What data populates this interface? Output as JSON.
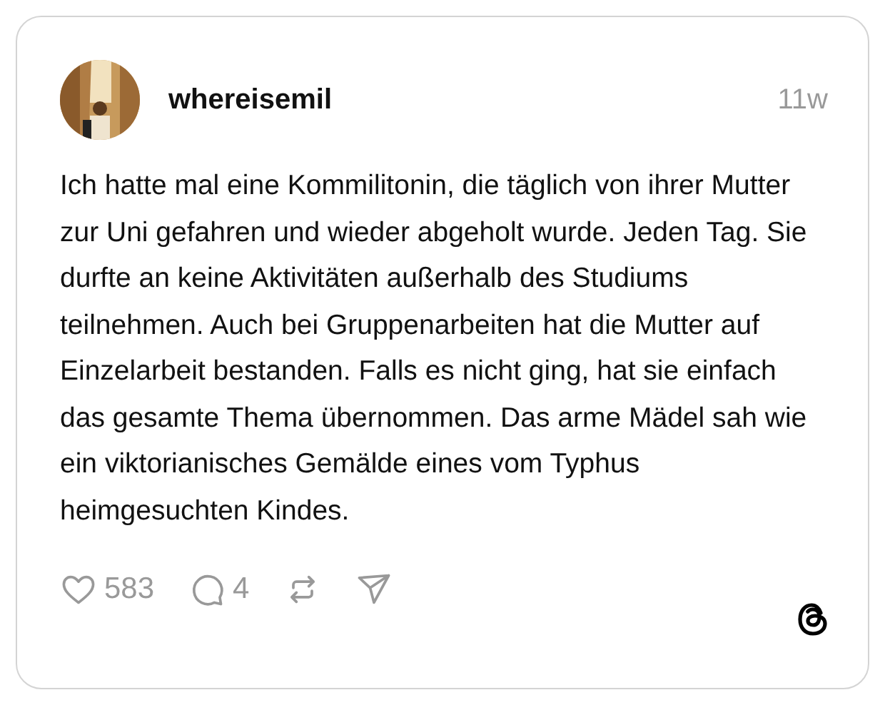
{
  "post": {
    "author": "whereisemil",
    "time": "11w",
    "text": "Ich hatte mal eine Kommilitonin, die täglich von ihrer Mutter zur Uni gefahren und wieder abgeholt wurde. Jeden Tag. Sie durfte an keine Aktivitäten außerhalb des Studiums teilnehmen. Auch bei Gruppenarbeiten hat die Mutter auf Einzelarbeit bestanden. Falls es nicht ging, hat sie einfach das gesamte Thema übernommen. Das arme Mädel sah wie ein viktorianisches Gemälde eines vom Typhus heimgesuchten Kindes.",
    "actions": [
      {
        "kind": "like",
        "count": "583"
      },
      {
        "kind": "reply",
        "count": "4"
      },
      {
        "kind": "repost"
      },
      {
        "kind": "share"
      }
    ]
  }
}
